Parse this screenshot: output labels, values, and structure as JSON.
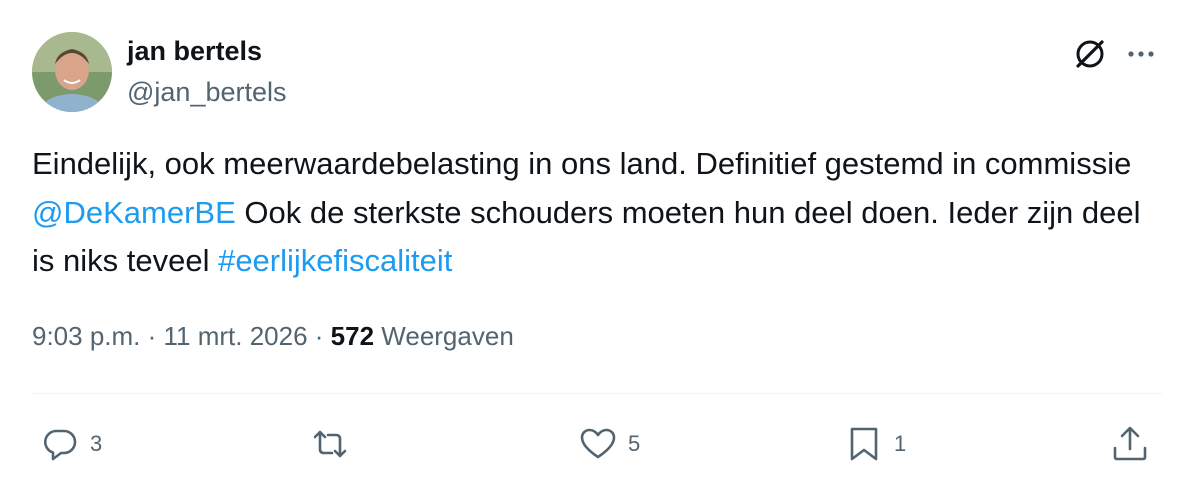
{
  "author": {
    "name": "jan bertels",
    "handle": "@jan_bertels"
  },
  "post": {
    "text_part1": "Eindelijk, ook meerwaardebelasting in ons land. Definitief gestemd in commissie ",
    "mention": "@DeKamerBE",
    "text_part2": " Ook de sterkste schouders moeten hun deel doen. Ieder zijn deel is niks teveel ",
    "hashtag": "#eerlijkefiscaliteit"
  },
  "meta": {
    "time": "9:03 p.m.",
    "sep1": " · ",
    "date": "11 mrt. 2026",
    "sep2": " · ",
    "views_count": "572",
    "views_label": " Weergaven"
  },
  "actions": {
    "reply_count": "3",
    "like_count": "5",
    "bookmark_count": "1"
  },
  "icons": {
    "grok": "grok-icon",
    "more": "more-icon",
    "reply": "reply-icon",
    "repost": "repost-icon",
    "like": "heart-icon",
    "bookmark": "bookmark-icon",
    "share": "share-icon"
  },
  "colors": {
    "text": "#0f1419",
    "secondary": "#536471",
    "link": "#1d9bf0",
    "divider": "#eff3f4"
  }
}
